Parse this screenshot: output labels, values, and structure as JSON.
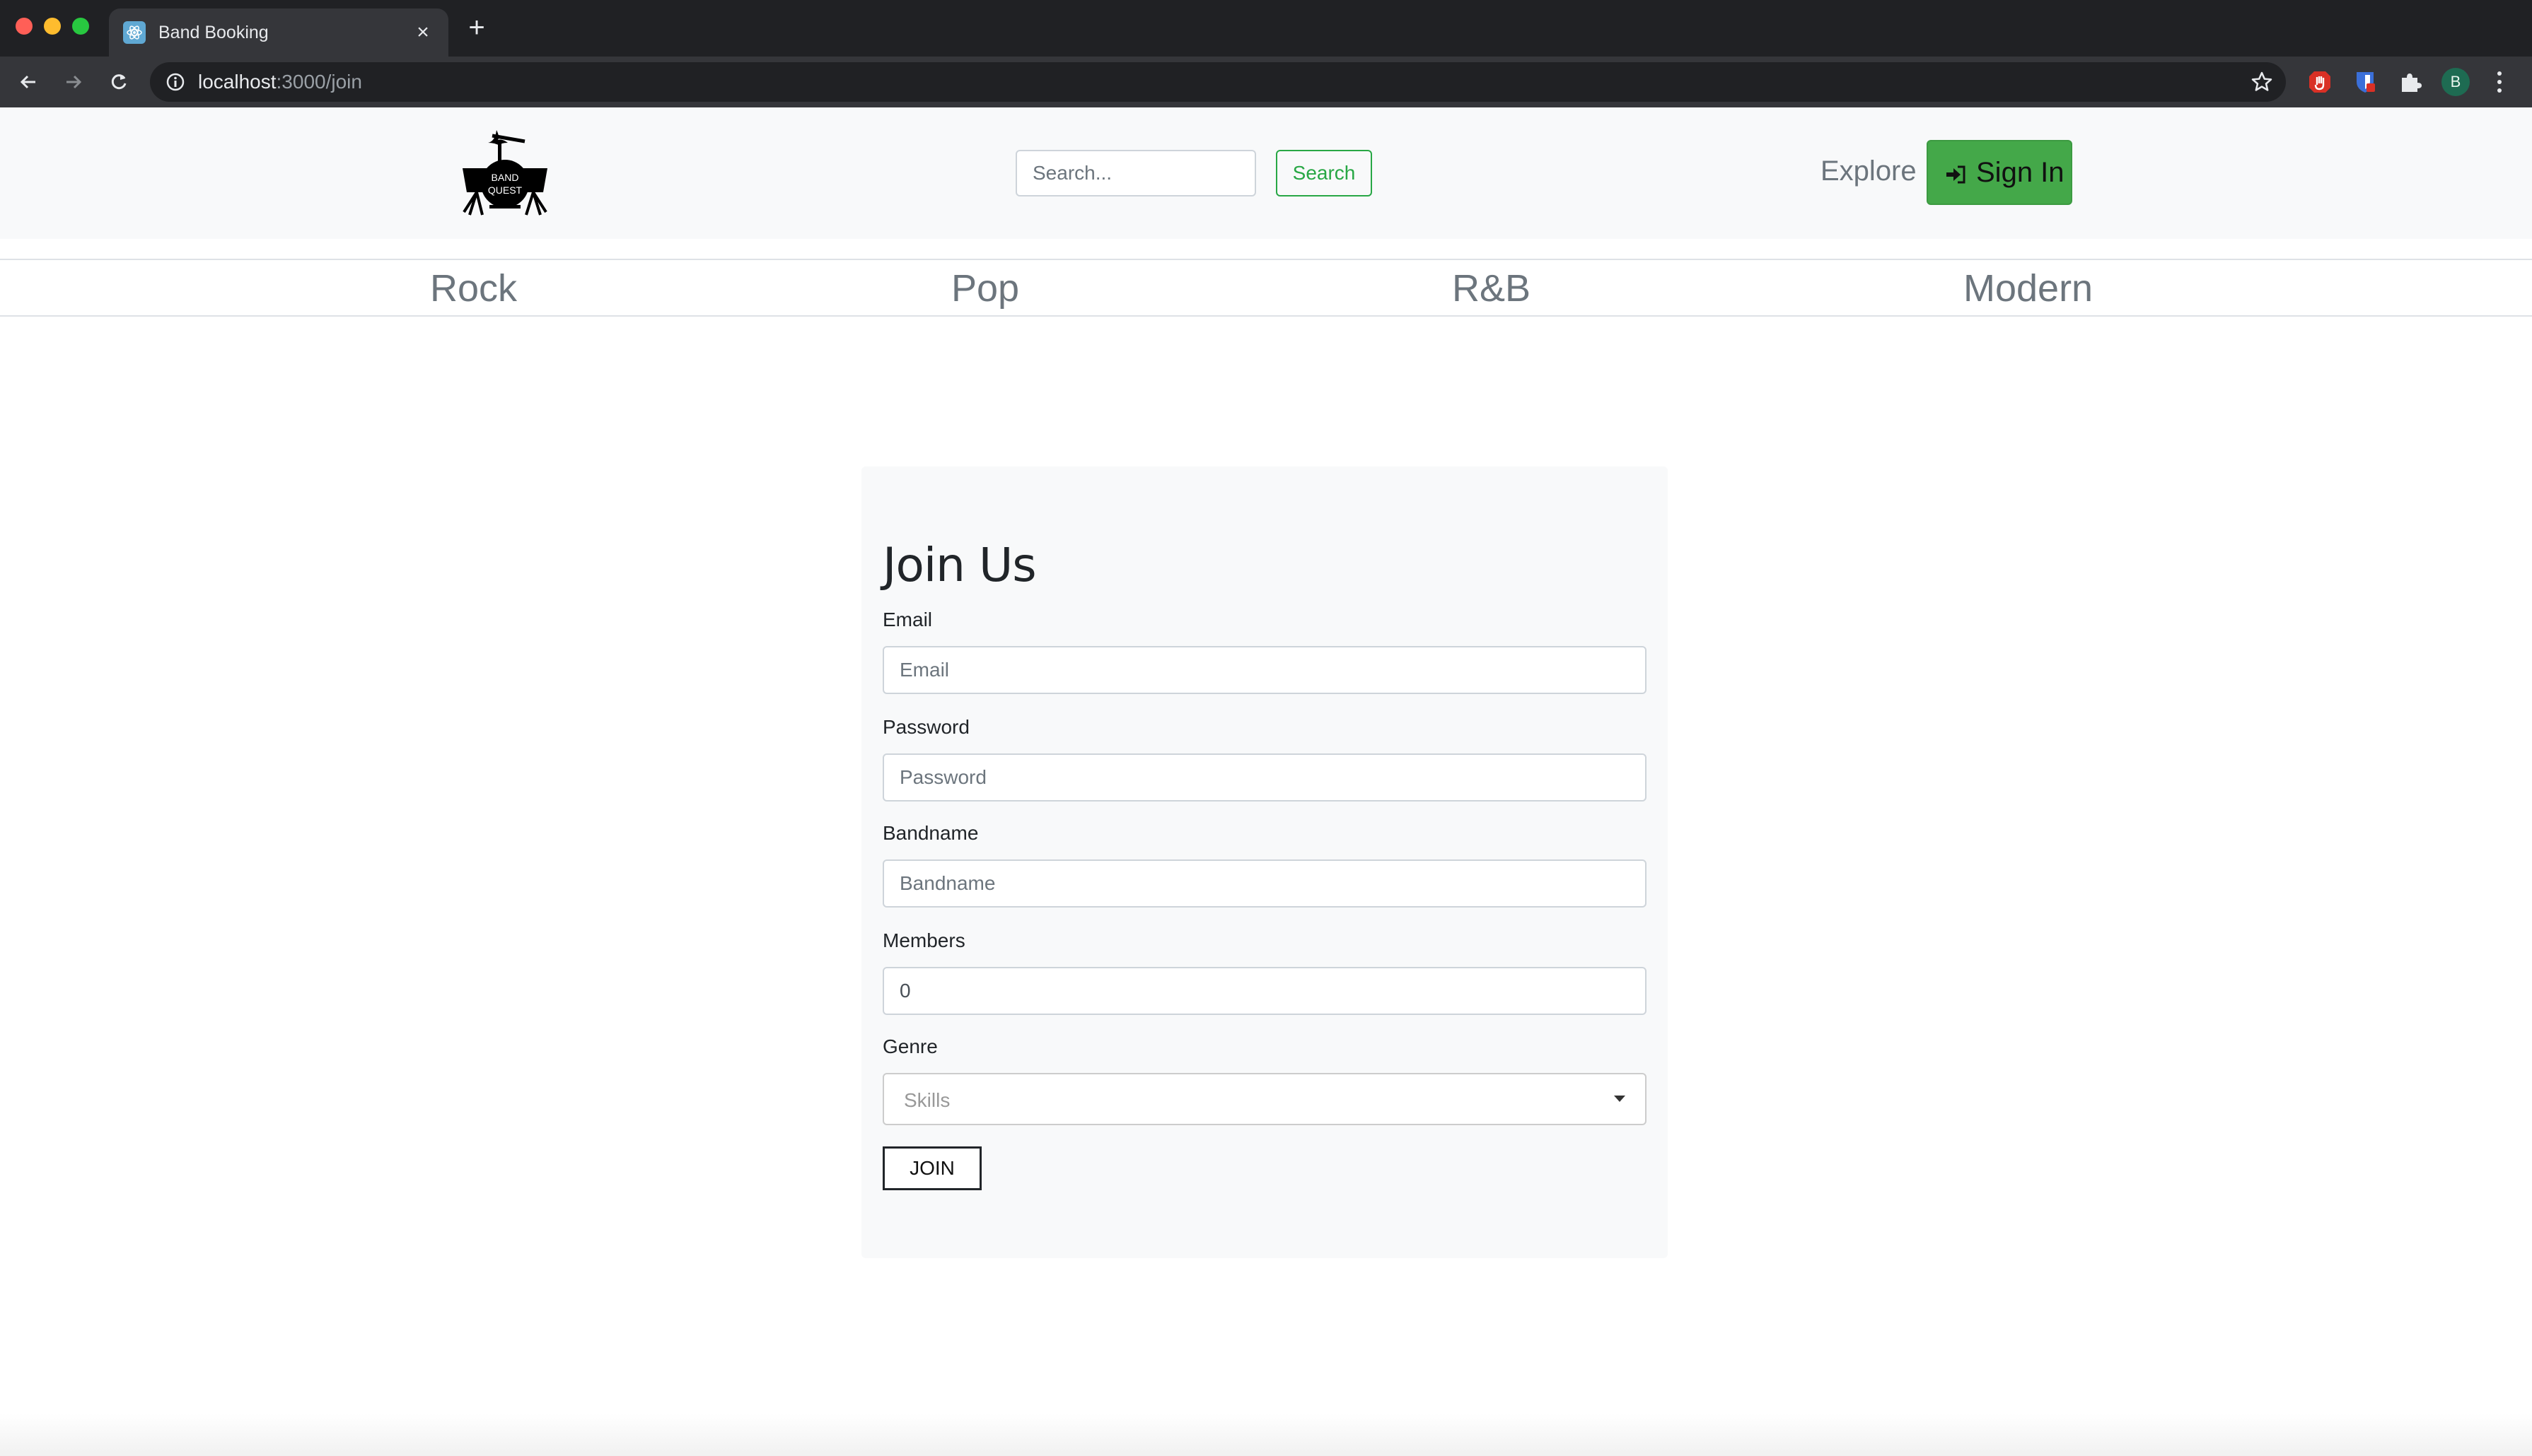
{
  "browser": {
    "tab_title": "Band Booking",
    "url_host": "localhost",
    "url_path": ":3000/join",
    "profile_initial": "B"
  },
  "header": {
    "search_placeholder": "Search...",
    "search_button": "Search",
    "explore_label": "Explore",
    "signin_label": "Sign In",
    "logo_text_line1": "BAND",
    "logo_text_line2": "QUEST"
  },
  "genres": [
    "Rock",
    "Pop",
    "R&B",
    "Modern"
  ],
  "form": {
    "title": "Join Us",
    "email_label": "Email",
    "email_placeholder": "Email",
    "password_label": "Password",
    "password_placeholder": "Password",
    "bandname_label": "Bandname",
    "bandname_placeholder": "Bandname",
    "members_label": "Members",
    "members_value": "0",
    "genre_label": "Genre",
    "genre_placeholder": "Skills",
    "submit_label": "JOIN"
  },
  "colors": {
    "brand_green": "#44a849",
    "outline_green": "#28a745",
    "header_bg": "#f8f9fa",
    "muted_text": "#6c757d"
  }
}
